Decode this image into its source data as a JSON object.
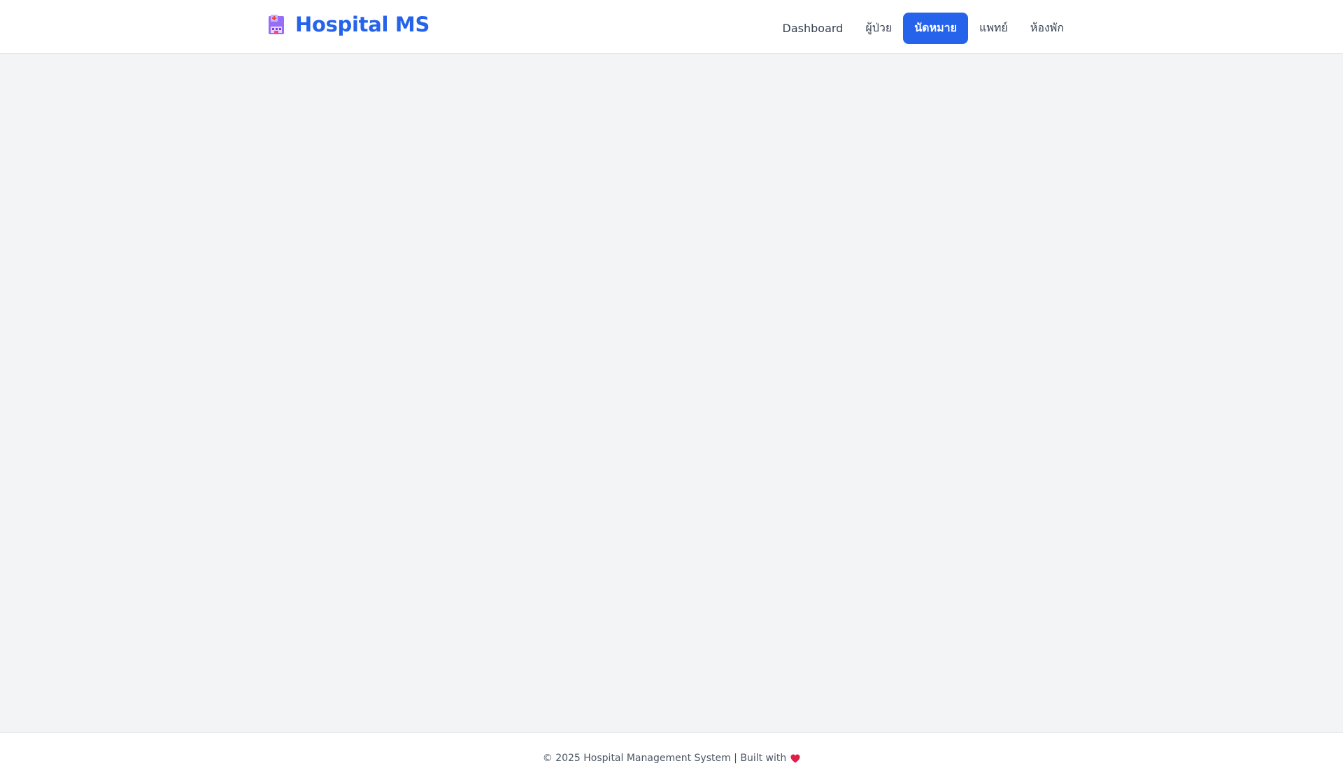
{
  "navbar": {
    "brand": {
      "icon": "hospital-icon",
      "title": "Hospital MS"
    },
    "links": [
      {
        "label": "Dashboard",
        "active": false
      },
      {
        "label": "ผู้ป่วย",
        "active": false
      },
      {
        "label": "นัดหมาย",
        "active": true
      },
      {
        "label": "แพทย์",
        "active": false
      },
      {
        "label": "ห้องพัก",
        "active": false
      }
    ]
  },
  "footer": {
    "text": "© 2025 Hospital Management System | Built with",
    "icon": "heart-icon"
  },
  "colors": {
    "accent": "#2563eb",
    "background": "#f3f4f6",
    "heart": "#e11d48"
  }
}
